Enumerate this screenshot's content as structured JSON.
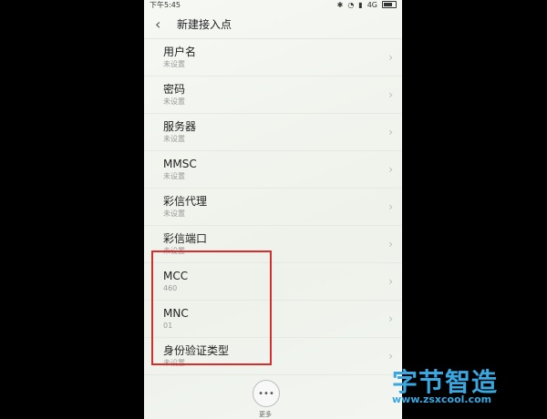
{
  "status": {
    "time": "下午5:45",
    "network": "4G"
  },
  "header": {
    "title": "新建接入点"
  },
  "rows": [
    {
      "label": "用户名",
      "value": "未设置"
    },
    {
      "label": "密码",
      "value": "未设置"
    },
    {
      "label": "服务器",
      "value": "未设置"
    },
    {
      "label": "MMSC",
      "value": "未设置"
    },
    {
      "label": "彩信代理",
      "value": "未设置"
    },
    {
      "label": "彩信端口",
      "value": "未设置"
    },
    {
      "label": "MCC",
      "value": "460"
    },
    {
      "label": "MNC",
      "value": "01"
    },
    {
      "label": "身份验证类型",
      "value": "未设置"
    }
  ],
  "footer": {
    "more_label": "更多"
  },
  "watermark": {
    "text": "字节智造",
    "sub": "www.zsxcool.com"
  },
  "colors": {
    "highlight": "#d62d2d",
    "watermark": "#3aa7e0"
  }
}
